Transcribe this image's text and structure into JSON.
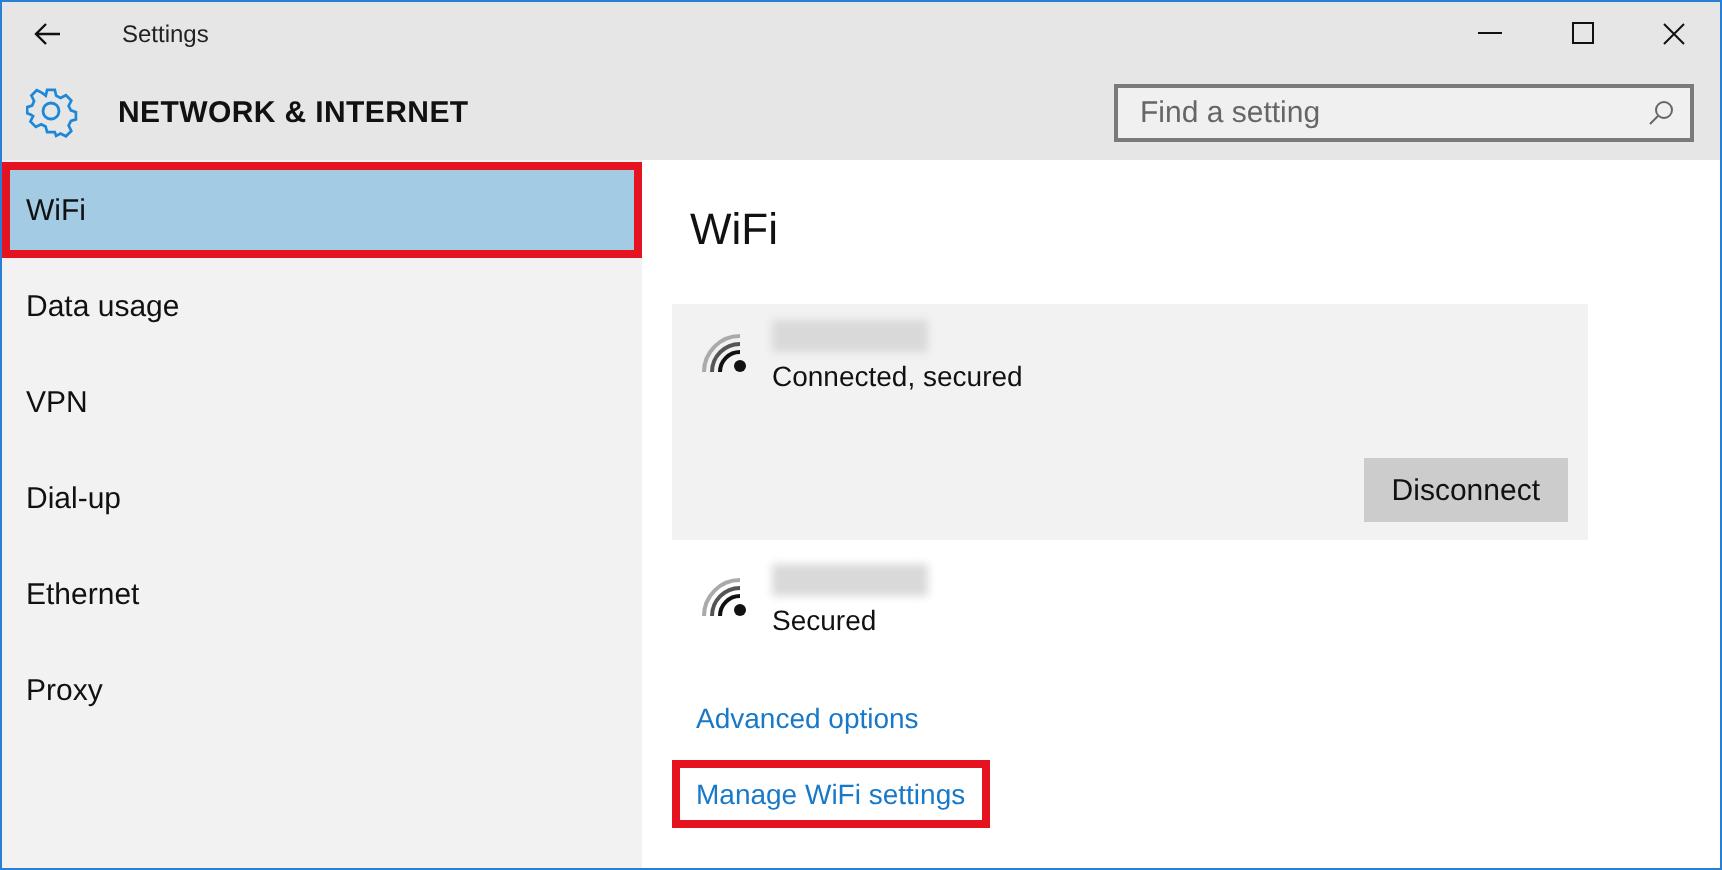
{
  "window": {
    "title": "Settings"
  },
  "header": {
    "title": "NETWORK & INTERNET",
    "search": {
      "placeholder": "Find a setting"
    }
  },
  "sidebar": {
    "items": [
      {
        "label": "WiFi",
        "selected": true,
        "highlighted": true
      },
      {
        "label": "Data usage",
        "selected": false,
        "highlighted": false
      },
      {
        "label": "VPN",
        "selected": false,
        "highlighted": false
      },
      {
        "label": "Dial-up",
        "selected": false,
        "highlighted": false
      },
      {
        "label": "Ethernet",
        "selected": false,
        "highlighted": false
      },
      {
        "label": "Proxy",
        "selected": false,
        "highlighted": false
      }
    ]
  },
  "content": {
    "heading": "WiFi",
    "networks": [
      {
        "status": "Connected, secured",
        "selected": true,
        "button": "Disconnect"
      },
      {
        "status": "Secured",
        "selected": false
      }
    ],
    "links": [
      {
        "label": "Advanced options",
        "highlighted": false
      },
      {
        "label": "Manage WiFi settings",
        "highlighted": true
      }
    ]
  }
}
